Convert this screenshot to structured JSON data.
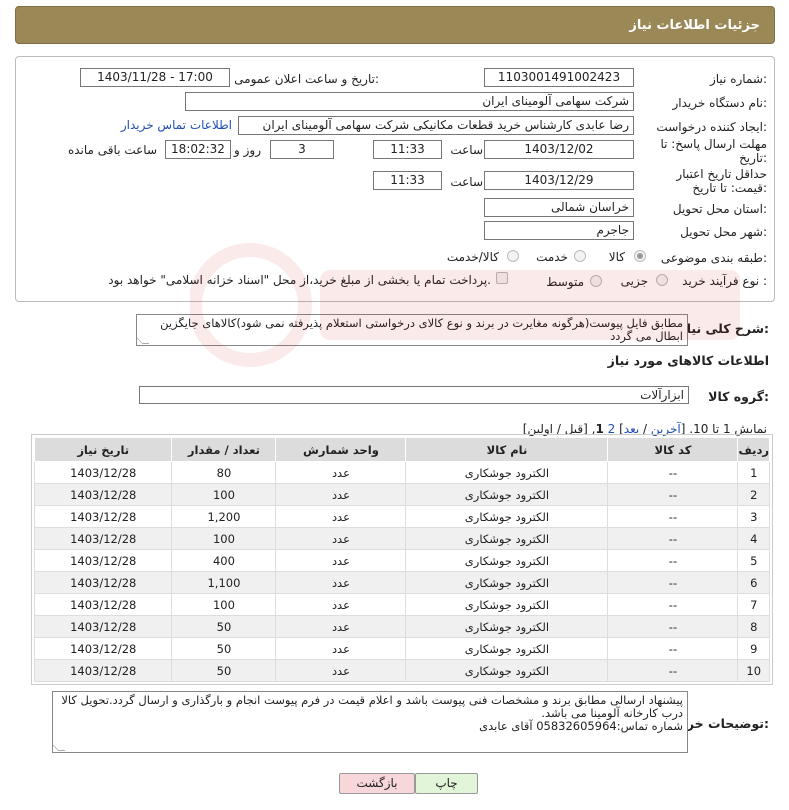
{
  "header": {
    "title": "جزئیات اطلاعات نیاز"
  },
  "form": {
    "need_number_label": "شماره نیاز:",
    "need_number": "1103001491002423",
    "announce_label": "تاریخ و ساعت اعلان عمومی:",
    "announce_value": "1403/11/28 - 17:00",
    "buyer_org_label": "نام دستگاه خریدار:",
    "buyer_org": "شرکت سهامی آلومینای ایران",
    "requester_label": "ایجاد کننده درخواست:",
    "requester": "رضا عابدی کارشناس خرید قطعات مکانیکی شرکت سهامی آلومینای ایران",
    "contact_link": "اطلاعات تماس خریدار",
    "deadline_label": "مهلت ارسال پاسخ: تا تاریخ:",
    "deadline_date": "1403/12/02",
    "time_label": "ساعت",
    "deadline_time": "11:33",
    "days_value": "3",
    "days_label": "روز و",
    "remaining_time": "18:02:32",
    "remaining_label": "ساعت باقی مانده",
    "validity_label": "حداقل تاریخ اعتبار قیمت: تا تاریخ:",
    "validity_date": "1403/12/29",
    "validity_time": "11:33",
    "province_label": "استان محل تحویل:",
    "province": "خراسان شمالی",
    "city_label": "شهر محل تحویل:",
    "city": "جاجرم",
    "category_label": "طبقه بندی موضوعی:",
    "category_options": [
      "کالا",
      "خدمت",
      "کالا/خدمت"
    ],
    "process_label": "نوع فرآیند خرید :",
    "process_options": [
      "جزیی",
      "متوسط"
    ],
    "payment_note": "پرداخت تمام یا بخشی از مبلغ خرید،از محل \"اسناد خزانه اسلامی\" خواهد بود."
  },
  "summary": {
    "label": "شرح کلی نیاز:",
    "text": "مطابق فایل پیوست(هرگونه مغایرت در برند و نوع کالای درخواستی استعلام پذیرفته نمی شود)کالاهای جایگزین ابطال می گردد"
  },
  "goods_section": {
    "title": "اطلاعات کالاهای مورد نیاز",
    "group_label": "گروه کالا:",
    "group_value": "ابزارآلات",
    "pager_text": "نمایش 1 تا 10. [",
    "pager_last": "آخرین",
    "pager_next": "بعد",
    "pager_page2": "2",
    "pager_page1": "1",
    "pager_tail": ", [قبل / اولین]"
  },
  "table": {
    "headers": [
      "ردیف",
      "کد کالا",
      "نام کالا",
      "واحد شمارش",
      "تعداد / مقدار",
      "تاریخ نیاز"
    ],
    "rows": [
      [
        "1",
        "--",
        "الکترود جوشکاری",
        "عدد",
        "80",
        "1403/12/28"
      ],
      [
        "2",
        "--",
        "الکترود جوشکاری",
        "عدد",
        "100",
        "1403/12/28"
      ],
      [
        "3",
        "--",
        "الکترود جوشکاری",
        "عدد",
        "1,200",
        "1403/12/28"
      ],
      [
        "4",
        "--",
        "الکترود جوشکاری",
        "عدد",
        "100",
        "1403/12/28"
      ],
      [
        "5",
        "--",
        "الکترود جوشکاری",
        "عدد",
        "400",
        "1403/12/28"
      ],
      [
        "6",
        "--",
        "الکترود جوشکاری",
        "عدد",
        "1,100",
        "1403/12/28"
      ],
      [
        "7",
        "--",
        "الکترود جوشکاری",
        "عدد",
        "100",
        "1403/12/28"
      ],
      [
        "8",
        "--",
        "الکترود جوشکاری",
        "عدد",
        "50",
        "1403/12/28"
      ],
      [
        "9",
        "--",
        "الکترود جوشکاری",
        "عدد",
        "50",
        "1403/12/28"
      ],
      [
        "10",
        "--",
        "الکترود جوشکاری",
        "عدد",
        "50",
        "1403/12/28"
      ]
    ]
  },
  "buyer_notes": {
    "label": "توضیحات خریدار:",
    "line1": "پیشنهاد ارسالی مطابق برند و مشخصات فنی پیوست باشد و اعلام قیمت در فرم پیوست انجام و بارگذاری و ارسال گردد.تحویل کالا درب کارخانه آلومینا می باشد.",
    "line2": "شماره تماس:05832605964 آقای عابدی"
  },
  "buttons": {
    "print": "چاپ",
    "back": "بازگشت"
  },
  "colors": {
    "header": "#9b8857",
    "link": "#1f4fb0",
    "back_button": "#f7d7da",
    "print_button": "#e3f5d9"
  }
}
